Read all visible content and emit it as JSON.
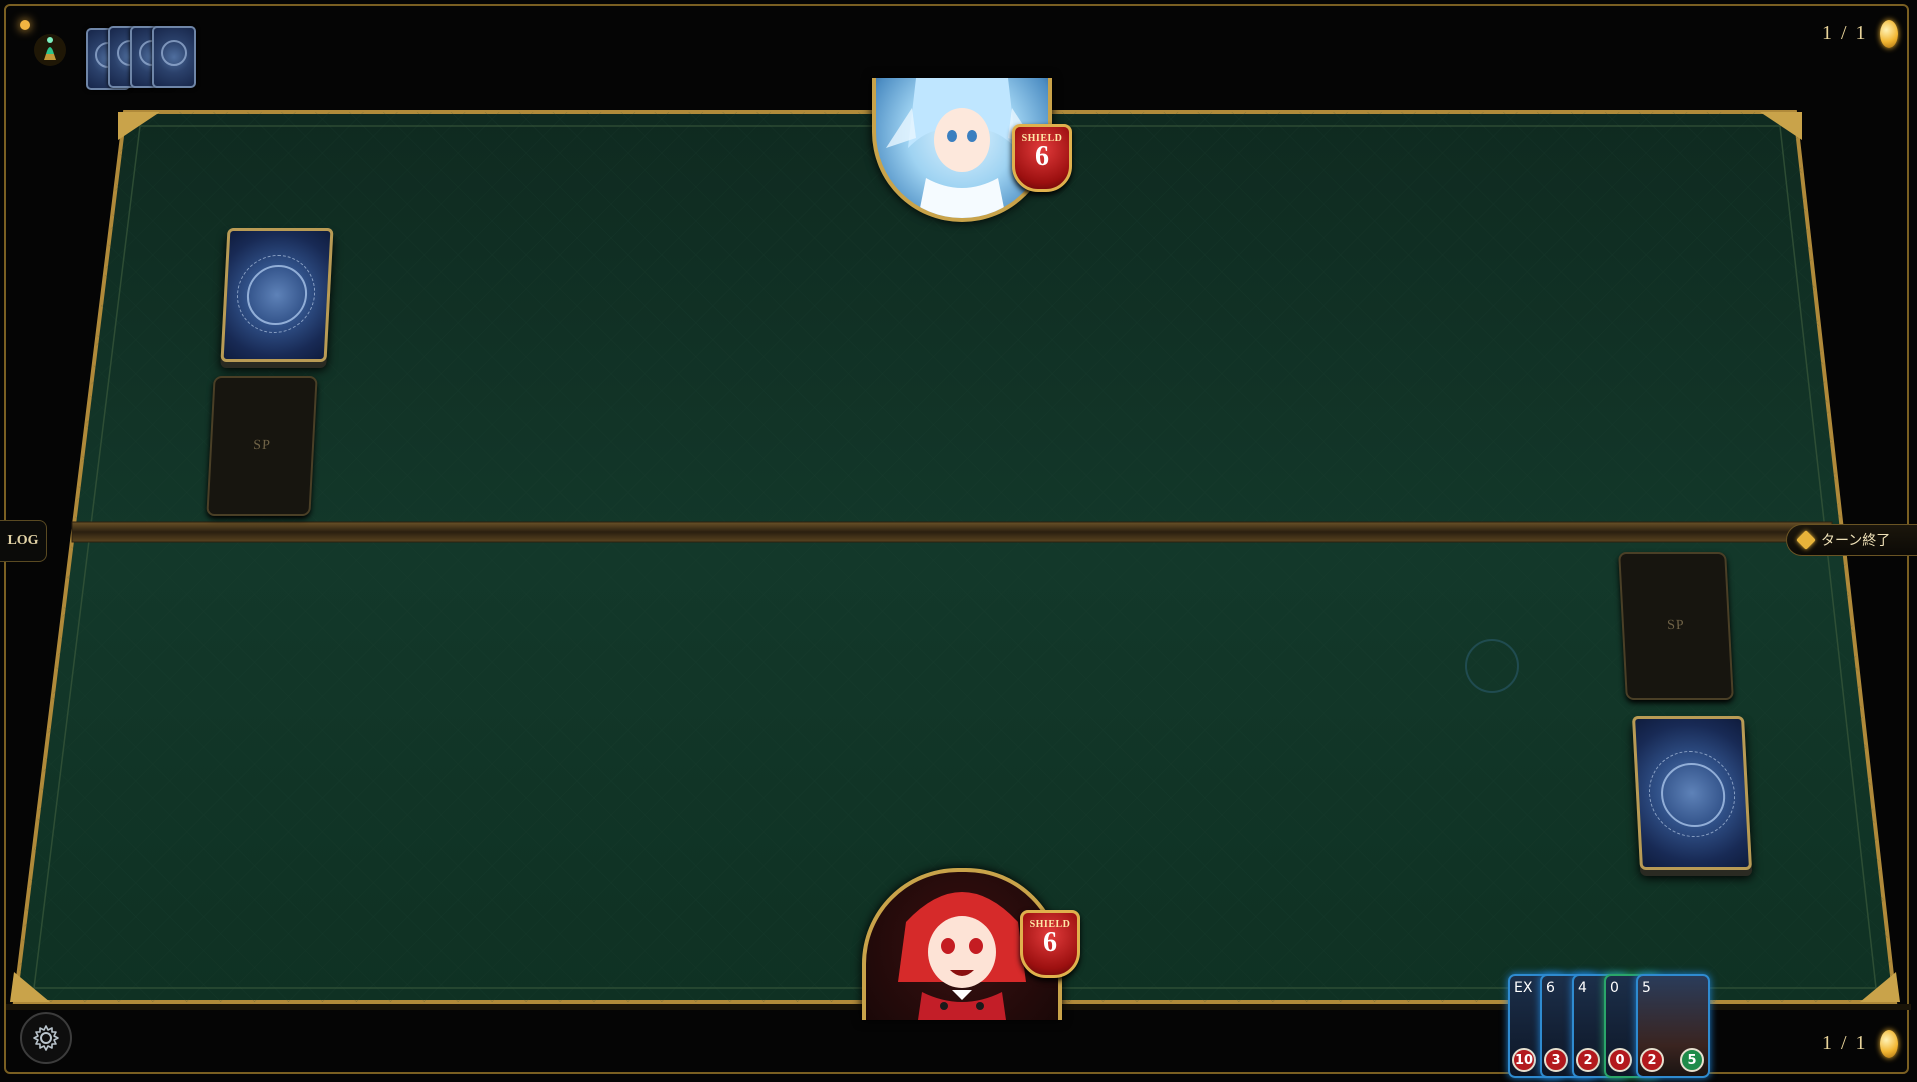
{
  "top_player": {
    "counter": "1 / 1",
    "shield_label": "SHIELD",
    "shield_value": "6",
    "sp_label": "SP"
  },
  "bottom_player": {
    "counter": "1 / 1",
    "shield_label": "SHIELD",
    "shield_value": "6",
    "sp_label": "SP"
  },
  "controls": {
    "log_label": "LOG",
    "end_turn_label": "ターン終了"
  },
  "hand": [
    {
      "cost": "EX",
      "stats": [
        "10"
      ],
      "stat_colors": [
        "red"
      ]
    },
    {
      "cost": "6",
      "stats": [
        "3"
      ],
      "stat_colors": [
        "red"
      ]
    },
    {
      "cost": "4",
      "stats": [
        "2"
      ],
      "stat_colors": [
        "red"
      ]
    },
    {
      "cost": "0",
      "stats": [
        "0"
      ],
      "stat_colors": [
        "red"
      ]
    },
    {
      "cost": "5",
      "stats": [
        "2",
        "5"
      ],
      "stat_colors": [
        "red",
        "green"
      ]
    }
  ],
  "colors": {
    "board_felt": "#103324",
    "gold_trim": "#c9a34a",
    "shield_red": "#b3191d"
  }
}
